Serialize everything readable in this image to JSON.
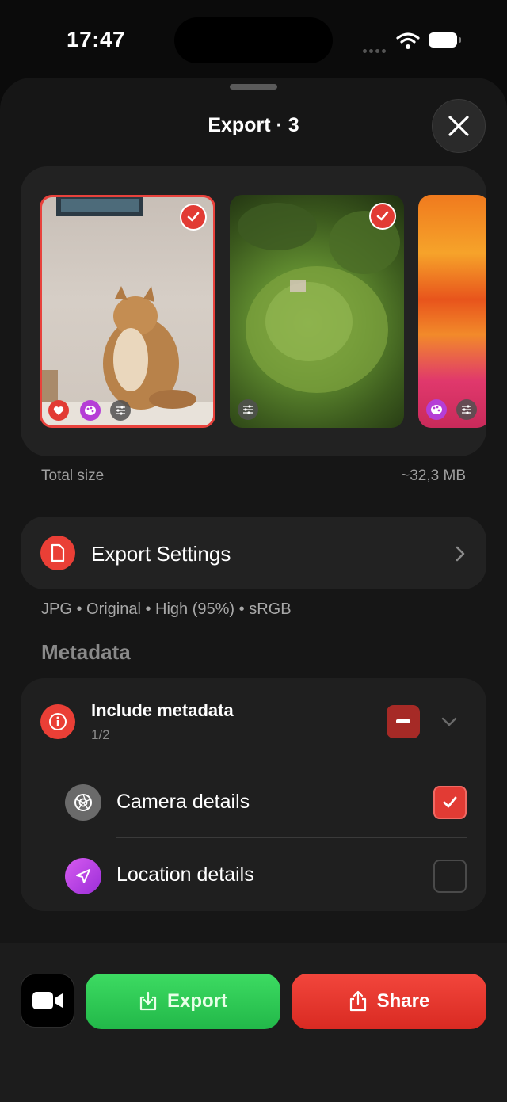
{
  "status": {
    "time": "17:47"
  },
  "sheet": {
    "title": "Export · 3"
  },
  "photos": [
    {
      "name": "cat-photo",
      "selected": true,
      "badges": [
        "heart-icon",
        "palette-icon",
        "sliders-icon"
      ]
    },
    {
      "name": "moss-photo",
      "selected": true,
      "badges": [
        "sliders-icon"
      ]
    },
    {
      "name": "flowers-photo",
      "selected": false,
      "badges": [
        "palette-icon",
        "sliders-icon"
      ]
    }
  ],
  "summary": {
    "label": "Total size",
    "value": "~32,3 MB"
  },
  "export_settings": {
    "label": "Export Settings",
    "format_line": "JPG • Original • High (95%) • sRGB"
  },
  "metadata": {
    "heading": "Metadata",
    "include_label": "Include metadata",
    "include_count": "1/2",
    "items": [
      {
        "label": "Camera details",
        "checked": true
      },
      {
        "label": "Location details",
        "checked": false
      }
    ]
  },
  "actions": {
    "export_label": "Export",
    "share_label": "Share"
  },
  "colors": {
    "accent_red": "#e23b34",
    "export_green": "#2fcb55",
    "background": "#161616"
  }
}
